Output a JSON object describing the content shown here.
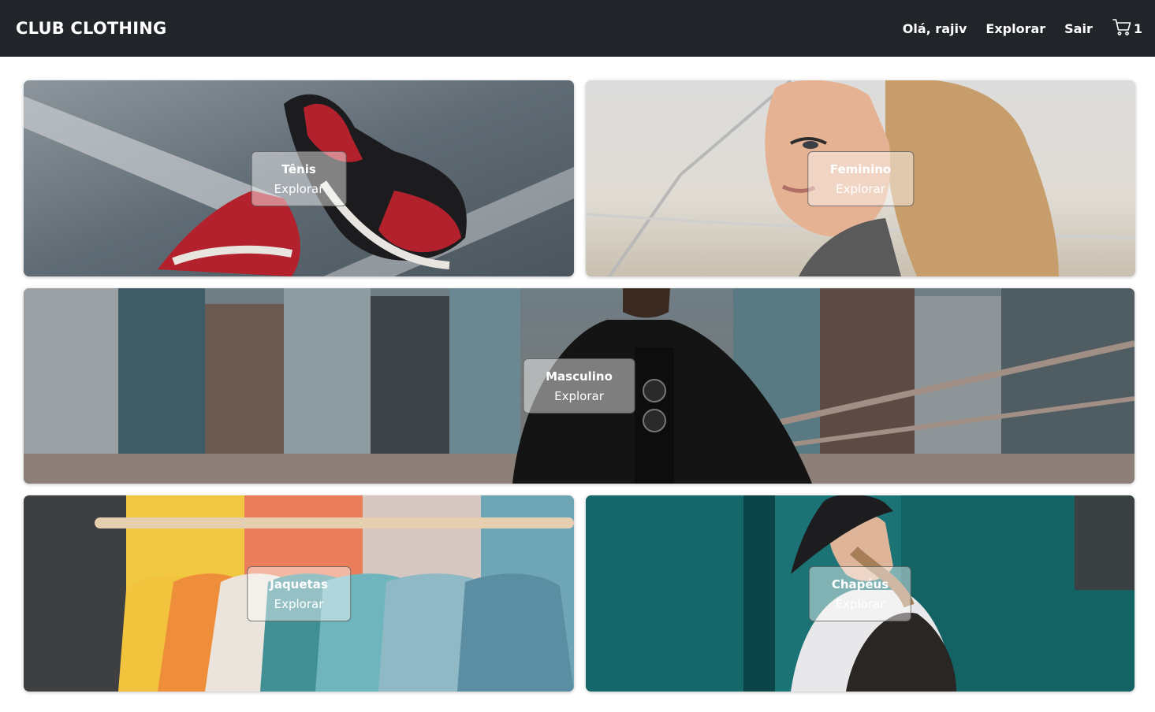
{
  "header": {
    "logo": "CLUB CLOTHING",
    "greeting": "Olá, rajiv",
    "explore_label": "Explorar",
    "logout_label": "Sair",
    "cart_icon": "shopping-cart-icon",
    "cart_count": "1"
  },
  "categories": [
    {
      "title": "Tênis",
      "subtitle": "Explorar"
    },
    {
      "title": "Feminino",
      "subtitle": "Explorar"
    },
    {
      "title": "Masculino",
      "subtitle": "Explorar"
    },
    {
      "title": "Jaquetas",
      "subtitle": "Explorar"
    },
    {
      "title": "Chapéus",
      "subtitle": "Explorar"
    }
  ],
  "colors": {
    "navbar_bg": "#212429",
    "text_light": "#ffffff"
  }
}
